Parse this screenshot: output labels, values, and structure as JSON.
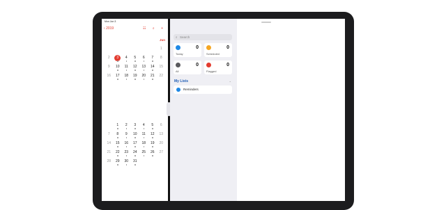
{
  "calendar": {
    "status_time": "Mon Jun 3",
    "back_label": "2019",
    "icons_label": "☷ ⌕ +",
    "month_label": "Jun",
    "weeks_top": [
      [
        "",
        "",
        "",
        "",
        "",
        "",
        "1"
      ],
      [
        "2",
        "3",
        "4",
        "5",
        "6",
        "7",
        "8"
      ],
      [
        "9",
        "10",
        "11",
        "12",
        "13",
        "14",
        "15"
      ],
      [
        "16",
        "17",
        "18",
        "19",
        "20",
        "21",
        "22"
      ]
    ],
    "weeks_bottom": [
      [
        "",
        "1",
        "2",
        "3",
        "4",
        "5",
        "6"
      ],
      [
        "7",
        "8",
        "9",
        "10",
        "11",
        "12",
        "13"
      ],
      [
        "14",
        "15",
        "16",
        "17",
        "18",
        "19",
        "20"
      ],
      [
        "21",
        "22",
        "23",
        "24",
        "25",
        "26",
        "27"
      ],
      [
        "28",
        "29",
        "30",
        "31",
        "",
        "",
        ""
      ]
    ],
    "today": "3"
  },
  "reminders": {
    "search_placeholder": "Search",
    "search_icon": "search-icon",
    "cards": [
      {
        "label": "Today",
        "count": "0",
        "color": "#1e88e5",
        "icon": "calendar-icon"
      },
      {
        "label": "Scheduled",
        "count": "0",
        "color": "#f5a623",
        "icon": "clock-icon"
      },
      {
        "label": "All",
        "count": "0",
        "color": "#5a5a5e",
        "icon": "tray-icon"
      },
      {
        "label": "Flagged",
        "count": "0",
        "color": "#e33b2f",
        "icon": "flag-icon"
      }
    ],
    "my_lists_label": "My Lists",
    "lists": [
      {
        "label": "Reminders",
        "count": "0",
        "color": "#1e88e5"
      }
    ]
  },
  "colors": {
    "accent_red": "#e33b2f",
    "accent_blue": "#1f5db5",
    "sidebar_bg": "#efeff4"
  }
}
